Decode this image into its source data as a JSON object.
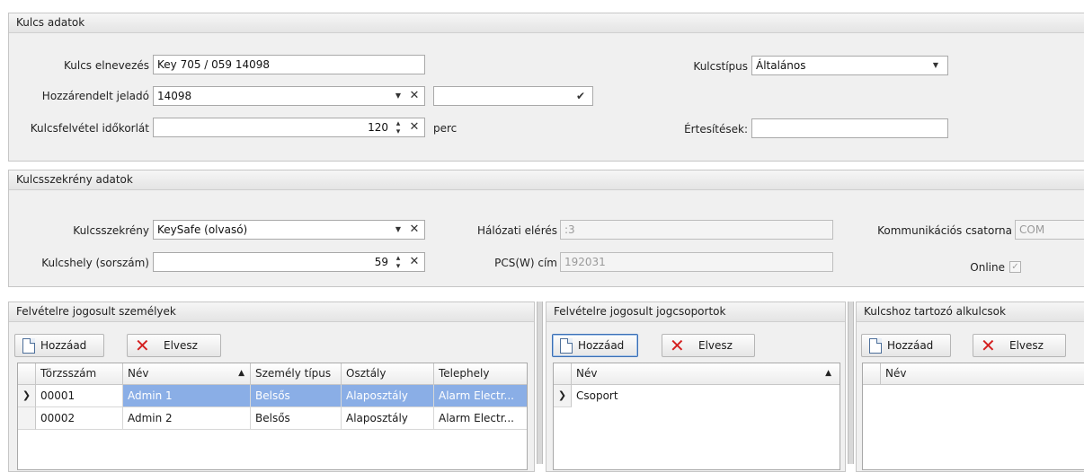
{
  "kulcs_adatok": {
    "title": "Kulcs adatok",
    "name_label": "Kulcs elnevezés",
    "name_value": "Key 705 / 059 14098",
    "transmitter_label": "Hozzárendelt jeladó",
    "transmitter_value": "14098",
    "transmitter_extra_value": "",
    "timeout_label": "Kulcsfelvétel időkorlát",
    "timeout_value": "120",
    "timeout_unit": "perc",
    "type_label": "Kulcstípus",
    "type_value": "Általános",
    "notify_label": "Értesítések:",
    "notify_value": ""
  },
  "kulcsszekreny_adatok": {
    "title": "Kulcsszekrény adatok",
    "safe_label": "Kulcsszekrény",
    "safe_value": "KeySafe (olvasó)",
    "slot_label": "Kulcshely (sorszám)",
    "slot_value": "59",
    "net_label": "Hálózati elérés",
    "net_value": ":3",
    "pcs_label": "PCS(W) cím",
    "pcs_value": "192031",
    "comm_label": "Kommunikációs csatorna",
    "comm_value": "COM",
    "online_label": "Online",
    "online_checked": true
  },
  "persons": {
    "title": "Felvételre jogosult személyek",
    "add_label": "Hozzáad",
    "remove_label": "Elvesz",
    "columns": [
      "Törzsszám",
      "Név",
      "Személy típus",
      "Osztály",
      "Telephely"
    ],
    "rows": [
      [
        "00001",
        "Admin 1",
        "Belsős",
        "Alaposztály",
        "Alarm Electr..."
      ],
      [
        "00002",
        "Admin 2",
        "Belsős",
        "Alaposztály",
        "Alarm Electr..."
      ]
    ]
  },
  "groups": {
    "title": "Felvételre jogosult jogcsoportok",
    "add_label": "Hozzáad",
    "remove_label": "Elvesz",
    "column": "Név",
    "rows": [
      "Csoport"
    ]
  },
  "subkeys": {
    "title": "Kulcshoz tartozó alkulcsok",
    "add_label": "Hozzáad",
    "remove_label": "Elvesz",
    "column": "Név"
  },
  "colors": {
    "selected_row": "#8aaee6",
    "remove_icon": "#d42020"
  },
  "icons": {
    "dropdown": "chevron-down-icon",
    "clear": "clear-x-icon",
    "spin": "spin-updown-icon",
    "confirm": "checkmark-icon",
    "add": "new-document-icon",
    "remove": "red-x-icon",
    "sort": "sort-ascending-icon",
    "row_indicator": "row-pointer-icon"
  }
}
